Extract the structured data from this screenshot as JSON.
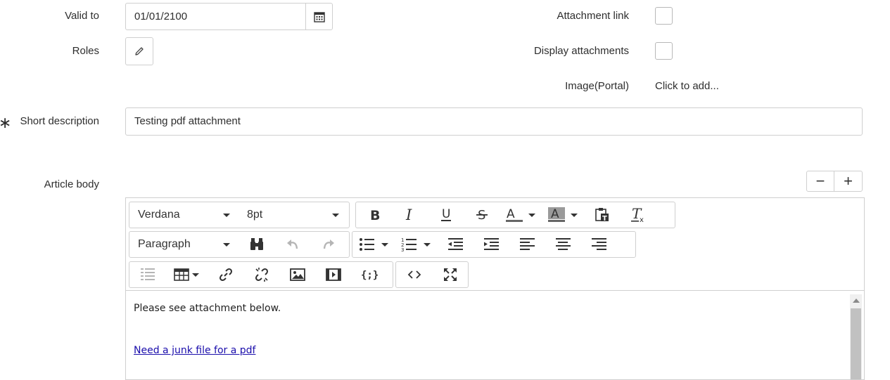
{
  "form": {
    "valid_to": {
      "label": "Valid to",
      "value": "01/01/2100"
    },
    "roles": {
      "label": "Roles"
    },
    "attachment_link": {
      "label": "Attachment link"
    },
    "display_attachments": {
      "label": "Display attachments"
    },
    "image_portal": {
      "label": "Image(Portal)",
      "value": "Click to add..."
    },
    "short_description": {
      "label": "Short description",
      "required_mark": "∗",
      "value": "Testing pdf attachment"
    },
    "article_body": {
      "label": "Article body"
    }
  },
  "editor": {
    "font_family": "Verdana",
    "font_size": "8pt",
    "block_format": "Paragraph",
    "zoom_out_label": "−",
    "zoom_in_label": "+",
    "content": {
      "paragraph": "Please see attachment below.",
      "link_text": "Need a junk file for a pdf"
    },
    "toolbar_icons": [
      "bold-icon",
      "italic-icon",
      "underline-icon",
      "strikethrough-icon",
      "text-color-icon",
      "background-color-icon",
      "paste-as-text-icon",
      "clear-formatting-icon",
      "find-replace-icon",
      "undo-icon",
      "redo-icon",
      "bullet-list-icon",
      "numbered-list-icon",
      "outdent-icon",
      "indent-icon",
      "align-left-icon",
      "align-center-icon",
      "align-right-icon",
      "list-style-icon",
      "table-icon",
      "link-icon",
      "unlink-icon",
      "image-icon",
      "video-icon",
      "code-sample-icon",
      "source-code-icon",
      "fullscreen-icon"
    ]
  }
}
